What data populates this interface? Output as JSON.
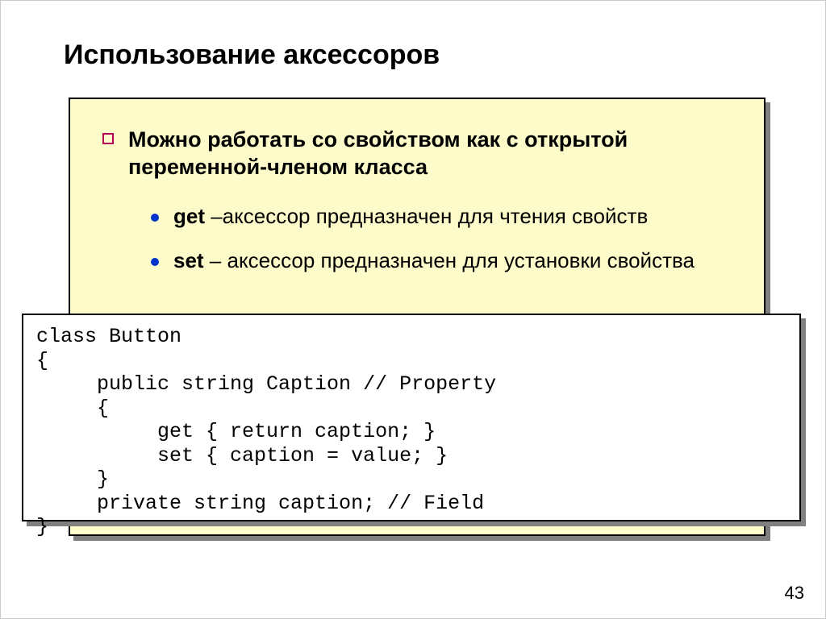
{
  "title": "Использование аксессоров",
  "bullets": [
    {
      "text": "Можно работать со свойством как с открытой переменной-членом класса",
      "sub": [
        {
          "bold": "get",
          "rest": " –аксессор предназначен для чтения свойств"
        },
        {
          "bold": "set",
          "rest": " – аксессор предназначен для установки свойства"
        }
      ]
    }
  ],
  "code": "class Button\n{\n     public string Caption // Property\n     {\n          get { return caption; }\n          set { caption = value; }\n     }\n     private string caption; // Field\n}",
  "page_number": "43"
}
